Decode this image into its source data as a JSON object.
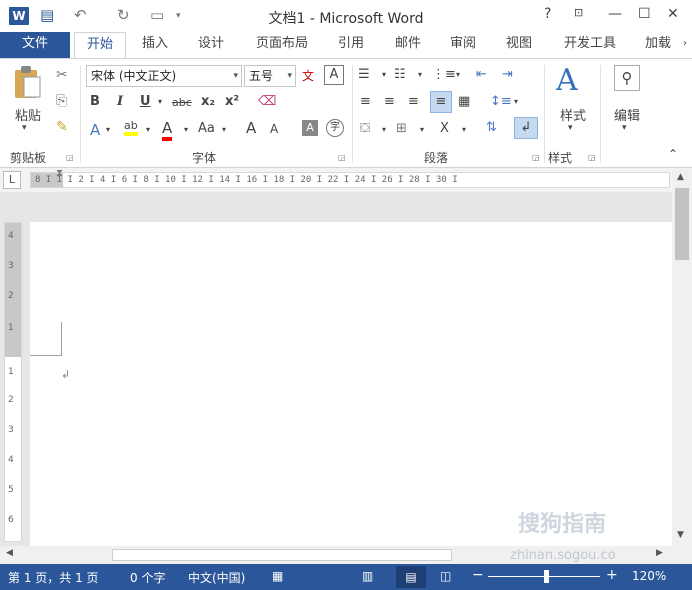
{
  "titlebar": {
    "app_icon": "W",
    "save_icon": "save-icon",
    "undo_icon": "undo-icon",
    "redo_icon": "redo-icon",
    "title": "文档1 - Microsoft Word",
    "help": "?",
    "ribbon_display": "ribbon-display-icon",
    "minimize": "—",
    "maximize": "☐",
    "close": "✕"
  },
  "tabs": [
    "文件",
    "开始",
    "插入",
    "设计",
    "页面布局",
    "引用",
    "邮件",
    "审阅",
    "视图",
    "开发工具",
    "加载"
  ],
  "ribbon": {
    "clipboard": {
      "paste": "粘贴",
      "label": "剪贴板"
    },
    "font": {
      "name": "宋体 (中文正文)",
      "size": "五号",
      "wen": "文",
      "bold": "B",
      "italic": "I",
      "underline": "U",
      "strike": "abc",
      "subscript": "x₂",
      "superscript": "x²",
      "font_color": "A",
      "change_case": "Aa",
      "grow": "A",
      "shrink": "A",
      "label": "字体"
    },
    "paragraph": {
      "label": "段落"
    },
    "styles": {
      "label_btn": "样式",
      "label": "样式"
    },
    "editing": {
      "label": "编辑"
    }
  },
  "ruler": {
    "corner": "L",
    "text": "8 I 1 I 2 I 4 I 6 I 8 I 10 I 12 I 14 I 16 I 18 I 20 I 22 I 24 I 26 I 28 I 30 I",
    "vertical": [
      "4",
      "3",
      "2",
      "1",
      "1",
      "2",
      "3",
      "4",
      "5",
      "6"
    ]
  },
  "document": {
    "pilcrow": "↲"
  },
  "watermark": {
    "brand": "搜狗指南",
    "url": "zhinan.sogou.co"
  },
  "statusbar": {
    "page": "第 1 页，共 1 页",
    "words": "0 个字",
    "language": "中文(中国)",
    "zoom": "120%",
    "minus": "−",
    "plus": "+"
  },
  "colors": {
    "accent": "#2b579a",
    "highlight": "#ffff00",
    "font_red": "#ff0000"
  }
}
